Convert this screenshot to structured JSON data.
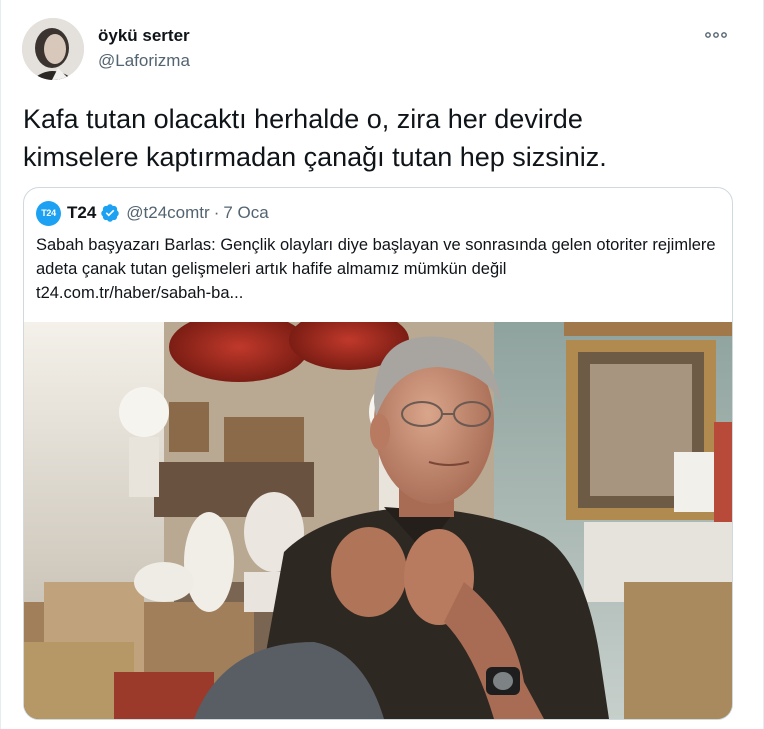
{
  "tweet": {
    "display_name": "öykü serter",
    "handle": "@Laforizma",
    "more_icon": "more-horizontal-icon",
    "text": "Kafa tutan olacaktı herhalde o, zira her devirde\nkimselere kaptırmadan çanağı tutan hep sizsiniz."
  },
  "quote": {
    "logo_text": "T24",
    "name": "T24",
    "verified_icon": "verified-badge-icon",
    "handle": "@t24comtr",
    "separator": "·",
    "date": "7 Oca",
    "text": "Sabah başyazarı Barlas: Gençlik olayları diye başlayan ve sonrasında gelen otoriter rejimlere adeta çanak tutan gelişmeleri artık hafife almamız mümkün değil",
    "link": "t24.com.tr/haber/sabah-ba..."
  },
  "colors": {
    "accent": "#1da1f2",
    "text_primary": "#0f1419",
    "text_secondary": "#536471",
    "border": "#cfd9de"
  }
}
